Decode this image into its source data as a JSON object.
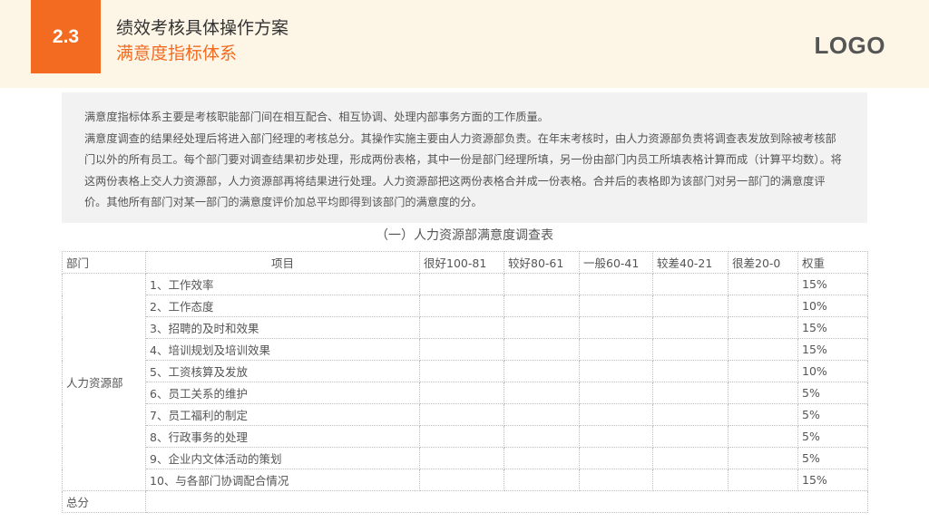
{
  "header": {
    "section_number": "2.3",
    "title": "绩效考核具体操作方案",
    "subtitle": "满意度指标体系",
    "logo": "LOGO"
  },
  "intro": {
    "paragraphs": [
      "满意度指标体系主要是考核职能部门间在相互配合、相互协调、处理内部事务方面的工作质量。",
      "满意度调查的结果经处理后将进入部门经理的考核总分。其操作实施主要由人力资源部负责。在年末考核时，由人力资源部负责将调查表发放到除被考核部门以外的所有员工。每个部门要对调查结果初步处理，形成两份表格，其中一份是部门经理所填，另一份由部门内员工所填表格计算而成（计算平均数）。将这两份表格上交人力资源部，人力资源部再将结果进行处理。人力资源部把这两份表格合并成一份表格。合并后的表格即为该部门对另一部门的满意度评价。其他所有部门对某一部门的满意度评价加总平均即得到该部门的满意度的分。"
    ]
  },
  "table": {
    "title": "（一）人力资源部满意度调查表",
    "headers": [
      "部门",
      "项目",
      "很好100-81",
      "较好80-61",
      "一般60-41",
      "较差40-21",
      "很差20-0",
      "权重"
    ],
    "department": "人力资源部",
    "rows": [
      {
        "item": "1、工作效率",
        "weight": "15%"
      },
      {
        "item": "2、工作态度",
        "weight": "10%"
      },
      {
        "item": "3、招聘的及时和效果",
        "weight": "15%"
      },
      {
        "item": "4、培训规划及培训效果",
        "weight": "15%"
      },
      {
        "item": "5、工资核算及发放",
        "weight": "10%"
      },
      {
        "item": "6、员工关系的维护",
        "weight": "5%"
      },
      {
        "item": "7、员工福利的制定",
        "weight": "5%"
      },
      {
        "item": "8、行政事务的处理",
        "weight": "5%"
      },
      {
        "item": "9、企业内文体活动的策划",
        "weight": "5%"
      },
      {
        "item": "10、与各部门协调配合情况",
        "weight": "15%"
      }
    ],
    "total_label": "总分"
  }
}
